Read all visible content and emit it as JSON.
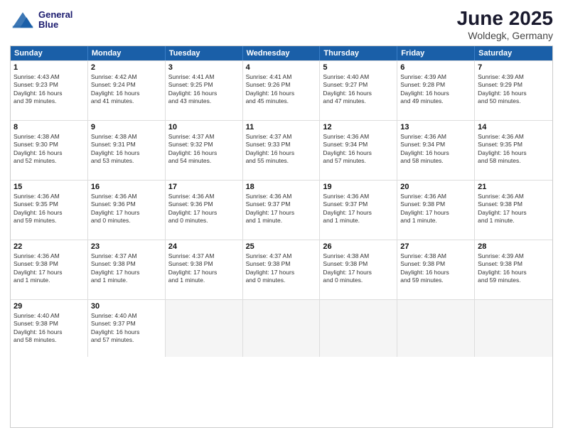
{
  "header": {
    "logo_line1": "General",
    "logo_line2": "Blue",
    "title": "June 2025",
    "subtitle": "Woldegk, Germany"
  },
  "calendar": {
    "days_of_week": [
      "Sunday",
      "Monday",
      "Tuesday",
      "Wednesday",
      "Thursday",
      "Friday",
      "Saturday"
    ],
    "weeks": [
      [
        {
          "day": "",
          "text": ""
        },
        {
          "day": "2",
          "text": "Sunrise: 4:42 AM\nSunset: 9:24 PM\nDaylight: 16 hours\nand 41 minutes."
        },
        {
          "day": "3",
          "text": "Sunrise: 4:41 AM\nSunset: 9:25 PM\nDaylight: 16 hours\nand 43 minutes."
        },
        {
          "day": "4",
          "text": "Sunrise: 4:41 AM\nSunset: 9:26 PM\nDaylight: 16 hours\nand 45 minutes."
        },
        {
          "day": "5",
          "text": "Sunrise: 4:40 AM\nSunset: 9:27 PM\nDaylight: 16 hours\nand 47 minutes."
        },
        {
          "day": "6",
          "text": "Sunrise: 4:39 AM\nSunset: 9:28 PM\nDaylight: 16 hours\nand 49 minutes."
        },
        {
          "day": "7",
          "text": "Sunrise: 4:39 AM\nSunset: 9:29 PM\nDaylight: 16 hours\nand 50 minutes."
        }
      ],
      [
        {
          "day": "8",
          "text": "Sunrise: 4:38 AM\nSunset: 9:30 PM\nDaylight: 16 hours\nand 52 minutes."
        },
        {
          "day": "9",
          "text": "Sunrise: 4:38 AM\nSunset: 9:31 PM\nDaylight: 16 hours\nand 53 minutes."
        },
        {
          "day": "10",
          "text": "Sunrise: 4:37 AM\nSunset: 9:32 PM\nDaylight: 16 hours\nand 54 minutes."
        },
        {
          "day": "11",
          "text": "Sunrise: 4:37 AM\nSunset: 9:33 PM\nDaylight: 16 hours\nand 55 minutes."
        },
        {
          "day": "12",
          "text": "Sunrise: 4:36 AM\nSunset: 9:34 PM\nDaylight: 16 hours\nand 57 minutes."
        },
        {
          "day": "13",
          "text": "Sunrise: 4:36 AM\nSunset: 9:34 PM\nDaylight: 16 hours\nand 58 minutes."
        },
        {
          "day": "14",
          "text": "Sunrise: 4:36 AM\nSunset: 9:35 PM\nDaylight: 16 hours\nand 58 minutes."
        }
      ],
      [
        {
          "day": "15",
          "text": "Sunrise: 4:36 AM\nSunset: 9:35 PM\nDaylight: 16 hours\nand 59 minutes."
        },
        {
          "day": "16",
          "text": "Sunrise: 4:36 AM\nSunset: 9:36 PM\nDaylight: 17 hours\nand 0 minutes."
        },
        {
          "day": "17",
          "text": "Sunrise: 4:36 AM\nSunset: 9:36 PM\nDaylight: 17 hours\nand 0 minutes."
        },
        {
          "day": "18",
          "text": "Sunrise: 4:36 AM\nSunset: 9:37 PM\nDaylight: 17 hours\nand 1 minute."
        },
        {
          "day": "19",
          "text": "Sunrise: 4:36 AM\nSunset: 9:37 PM\nDaylight: 17 hours\nand 1 minute."
        },
        {
          "day": "20",
          "text": "Sunrise: 4:36 AM\nSunset: 9:38 PM\nDaylight: 17 hours\nand 1 minute."
        },
        {
          "day": "21",
          "text": "Sunrise: 4:36 AM\nSunset: 9:38 PM\nDaylight: 17 hours\nand 1 minute."
        }
      ],
      [
        {
          "day": "22",
          "text": "Sunrise: 4:36 AM\nSunset: 9:38 PM\nDaylight: 17 hours\nand 1 minute."
        },
        {
          "day": "23",
          "text": "Sunrise: 4:37 AM\nSunset: 9:38 PM\nDaylight: 17 hours\nand 1 minute."
        },
        {
          "day": "24",
          "text": "Sunrise: 4:37 AM\nSunset: 9:38 PM\nDaylight: 17 hours\nand 1 minute."
        },
        {
          "day": "25",
          "text": "Sunrise: 4:37 AM\nSunset: 9:38 PM\nDaylight: 17 hours\nand 0 minutes."
        },
        {
          "day": "26",
          "text": "Sunrise: 4:38 AM\nSunset: 9:38 PM\nDaylight: 17 hours\nand 0 minutes."
        },
        {
          "day": "27",
          "text": "Sunrise: 4:38 AM\nSunset: 9:38 PM\nDaylight: 16 hours\nand 59 minutes."
        },
        {
          "day": "28",
          "text": "Sunrise: 4:39 AM\nSunset: 9:38 PM\nDaylight: 16 hours\nand 59 minutes."
        }
      ],
      [
        {
          "day": "29",
          "text": "Sunrise: 4:40 AM\nSunset: 9:38 PM\nDaylight: 16 hours\nand 58 minutes."
        },
        {
          "day": "30",
          "text": "Sunrise: 4:40 AM\nSunset: 9:37 PM\nDaylight: 16 hours\nand 57 minutes."
        },
        {
          "day": "",
          "text": ""
        },
        {
          "day": "",
          "text": ""
        },
        {
          "day": "",
          "text": ""
        },
        {
          "day": "",
          "text": ""
        },
        {
          "day": "",
          "text": ""
        }
      ]
    ],
    "week1_day1": {
      "day": "1",
      "text": "Sunrise: 4:43 AM\nSunset: 9:23 PM\nDaylight: 16 hours\nand 39 minutes."
    }
  }
}
